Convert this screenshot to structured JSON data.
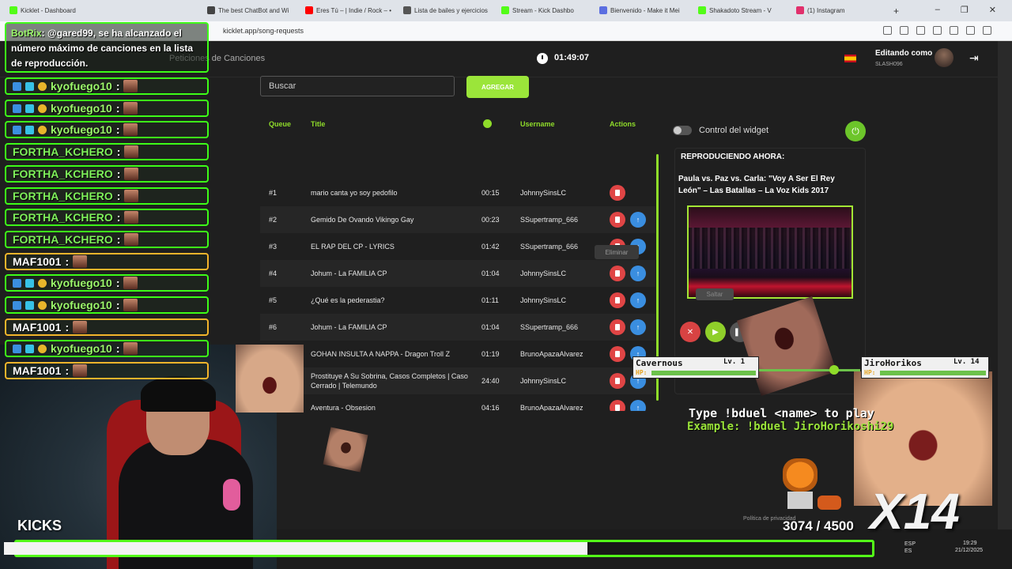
{
  "browser": {
    "tabs": [
      {
        "label": "Kicklet - Dashboard",
        "color": "#53fc18"
      },
      {
        "label": "The best ChatBot and Wi",
        "color": "#444444"
      },
      {
        "label": "Eres Tú – | Indie / Rock – •",
        "color": "#ff0000"
      },
      {
        "label": "Lista de bailes y ejercicios",
        "color": "#555555"
      },
      {
        "label": "Stream - Kick Dashbo",
        "color": "#53fc18"
      },
      {
        "label": "Bienvenido - Make it Mei",
        "color": "#5b6ee1"
      },
      {
        "label": "Shakadoto Stream - V",
        "color": "#53fc18"
      },
      {
        "label": "(1) Instagram",
        "color": "#e1306c"
      }
    ],
    "new_tab": "+",
    "window_controls": [
      "–",
      "❐",
      "✕"
    ],
    "url": "kicklet.app/song-requests"
  },
  "app": {
    "page_title": "Peticiones de Canciones",
    "editing_label": "Editando como",
    "editing_user": "SLASH096",
    "clock": "01:49:07",
    "search_placeholder": "Buscar",
    "add_button": "AGREGAR",
    "widget_control": "Control del widget",
    "now_playing_label": "REPRODUCIENDO AHORA:",
    "now_playing_title": "Paula vs. Paz vs. Carla: \"Voy A Ser El Rey León\" – Las Batallas – La Voz Kids 2017",
    "skip_tooltip": "Saltar",
    "delete_tooltip": "Eliminar",
    "footer": "Política de privacidad"
  },
  "queue": {
    "headers": {
      "queue": "Queue",
      "title": "Title",
      "username": "Username",
      "actions": "Actions"
    },
    "rows": [
      {
        "pos": "#1",
        "title": "mario canta yo soy pedofilo",
        "duration": "00:15",
        "user": "JohnnySinsLC",
        "up": false
      },
      {
        "pos": "#2",
        "title": "Gemido De Ovando Vikingo Gay",
        "duration": "00:23",
        "user": "SSupertramp_666",
        "up": true
      },
      {
        "pos": "#3",
        "title": "EL RAP DEL CP - LYRICS",
        "duration": "01:42",
        "user": "SSupertramp_666",
        "up": true
      },
      {
        "pos": "#4",
        "title": "Johum - La FAMILIA CP",
        "duration": "01:04",
        "user": "JohnnySinsLC",
        "up": true
      },
      {
        "pos": "#5",
        "title": "¿Qué es la pederastia?",
        "duration": "01:11",
        "user": "JohnnySinsLC",
        "up": true
      },
      {
        "pos": "#6",
        "title": "Johum - La FAMILIA CP",
        "duration": "01:04",
        "user": "SSupertramp_666",
        "up": true
      },
      {
        "pos": "",
        "title": "GOHAN INSULTA A NAPPA - Dragon Troll Z",
        "duration": "01:19",
        "user": "BrunoApazaAlvarez",
        "up": true
      },
      {
        "pos": "",
        "title": "Prostituye A Su Sobrina, Casos Completos | Caso Cerrado | Telemundo",
        "duration": "24:40",
        "user": "JohnnySinsLC",
        "up": true
      },
      {
        "pos": "",
        "title": "Aventura - Obsesion",
        "duration": "04:16",
        "user": "BrunoApazaAlvarez",
        "up": true
      }
    ]
  },
  "chat": {
    "bot_name": "BotRix",
    "bot_message": ": @gared99, se ha alcanzado el número máximo de canciones en la lista de reproducción.",
    "lines": [
      {
        "user": "kyofuego10",
        "style": "green",
        "badges": true
      },
      {
        "user": "kyofuego10",
        "style": "green",
        "badges": true
      },
      {
        "user": "kyofuego10",
        "style": "green",
        "badges": true
      },
      {
        "user": "FORTHA_KCHERO",
        "style": "fortha",
        "badges": false
      },
      {
        "user": "FORTHA_KCHERO",
        "style": "fortha",
        "badges": false
      },
      {
        "user": "FORTHA_KCHERO",
        "style": "fortha",
        "badges": false
      },
      {
        "user": "FORTHA_KCHERO",
        "style": "fortha",
        "badges": false
      },
      {
        "user": "FORTHA_KCHERO",
        "style": "fortha",
        "badges": false
      },
      {
        "user": "MAF1001",
        "style": "gold",
        "badges": false
      },
      {
        "user": "kyofuego10",
        "style": "green",
        "badges": true
      },
      {
        "user": "kyofuego10",
        "style": "green",
        "badges": true
      },
      {
        "user": "MAF1001",
        "style": "gold",
        "badges": false
      },
      {
        "user": "kyofuego10",
        "style": "green",
        "badges": true
      },
      {
        "user": "MAF1001",
        "style": "gold",
        "badges": false
      }
    ]
  },
  "stream": {
    "kicks_label": "KICKS",
    "kicks_count": "3074 / 4500",
    "kicks_progress": 0.683,
    "combo": "X14",
    "duel_instructions": "Type !bduel <name> to play",
    "duel_example": "Example: !bduel JiroHorikoshi29",
    "fighter_left": {
      "name": "Cavernous",
      "level": "Lv. 1",
      "hp_label": "HP:",
      "hp": 1.0
    },
    "fighter_right": {
      "name": "JiroHorikos",
      "level": "Lv. 14",
      "hp_label": "HP:",
      "hp": 1.0
    }
  },
  "taskbar": {
    "lang": "ESP\nES",
    "time": "19:29",
    "date": "21/12/2025"
  },
  "colors": {
    "accent": "#9be53a",
    "kick_green": "#53fc18",
    "delete": "#e04545",
    "move_up": "#3a8ee0"
  }
}
